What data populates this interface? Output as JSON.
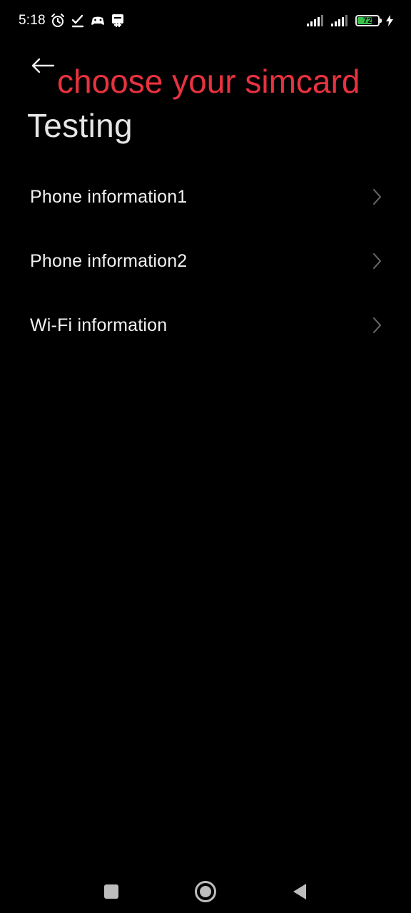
{
  "status_bar": {
    "time": "5:18",
    "battery_level": "72",
    "battery_fraction": 0.72,
    "icons_left": [
      "alarm-icon",
      "check-icon",
      "game-controller-icon",
      "notification-icon"
    ],
    "icons_right": [
      "signal-sim1-icon",
      "signal-sim2-icon",
      "battery-icon",
      "charging-icon"
    ],
    "battery_color": "#37c24a"
  },
  "header": {
    "overlay_text": "choose your simcard",
    "overlay_color": "#e8323f",
    "title": "Testing"
  },
  "list": {
    "items": [
      {
        "label": "Phone information1"
      },
      {
        "label": "Phone information2"
      },
      {
        "label": "Wi-Fi information"
      }
    ]
  },
  "nav_bar": {
    "buttons": [
      "recents-icon",
      "home-icon",
      "back-icon"
    ]
  }
}
